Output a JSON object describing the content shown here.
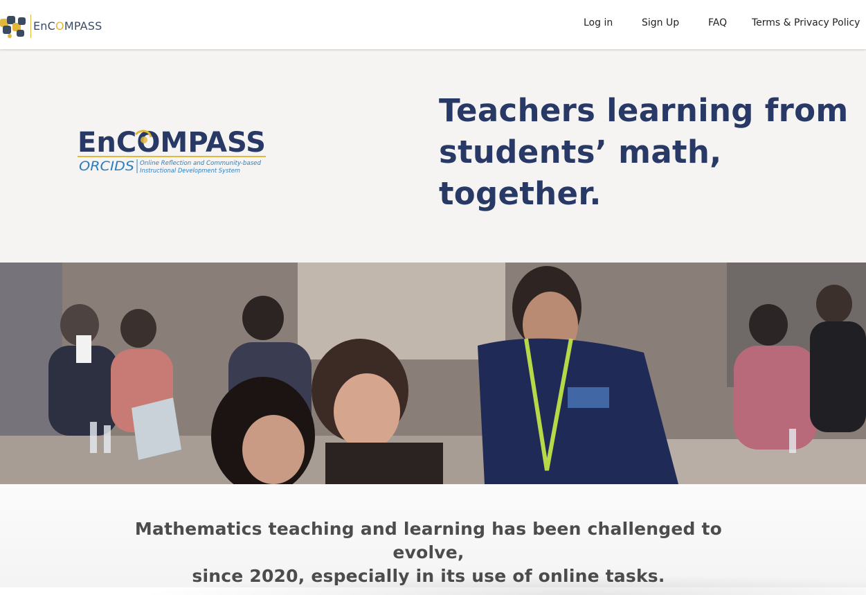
{
  "header": {
    "logo": {
      "prefix": "EnC",
      "o": "O",
      "suffix": "MPASS",
      "icon": "orcids-puzzle-logo"
    },
    "nav": [
      {
        "label": "Log in"
      },
      {
        "label": "Sign Up"
      },
      {
        "label": "FAQ"
      },
      {
        "label": "Terms & Privacy Policy"
      }
    ]
  },
  "hero": {
    "logo": {
      "name": "EnCOMPASS",
      "acronym": "ORCIDS",
      "tagline_line1": "Online Reflection and Community-based",
      "tagline_line2": "Instructional Development System"
    },
    "title": "Teachers learning from students’ math, together."
  },
  "photo": {
    "description_icon": "workshop-photo"
  },
  "intro": {
    "line1": "Mathematics teaching and learning has been challenged to evolve,",
    "line2": "since 2020, especially in its use of online tasks."
  },
  "colors": {
    "brand_navy": "#273964",
    "brand_gold": "#e0b93a",
    "brand_blue": "#2a7fc1",
    "hero_bg": "#f6f3f3"
  }
}
